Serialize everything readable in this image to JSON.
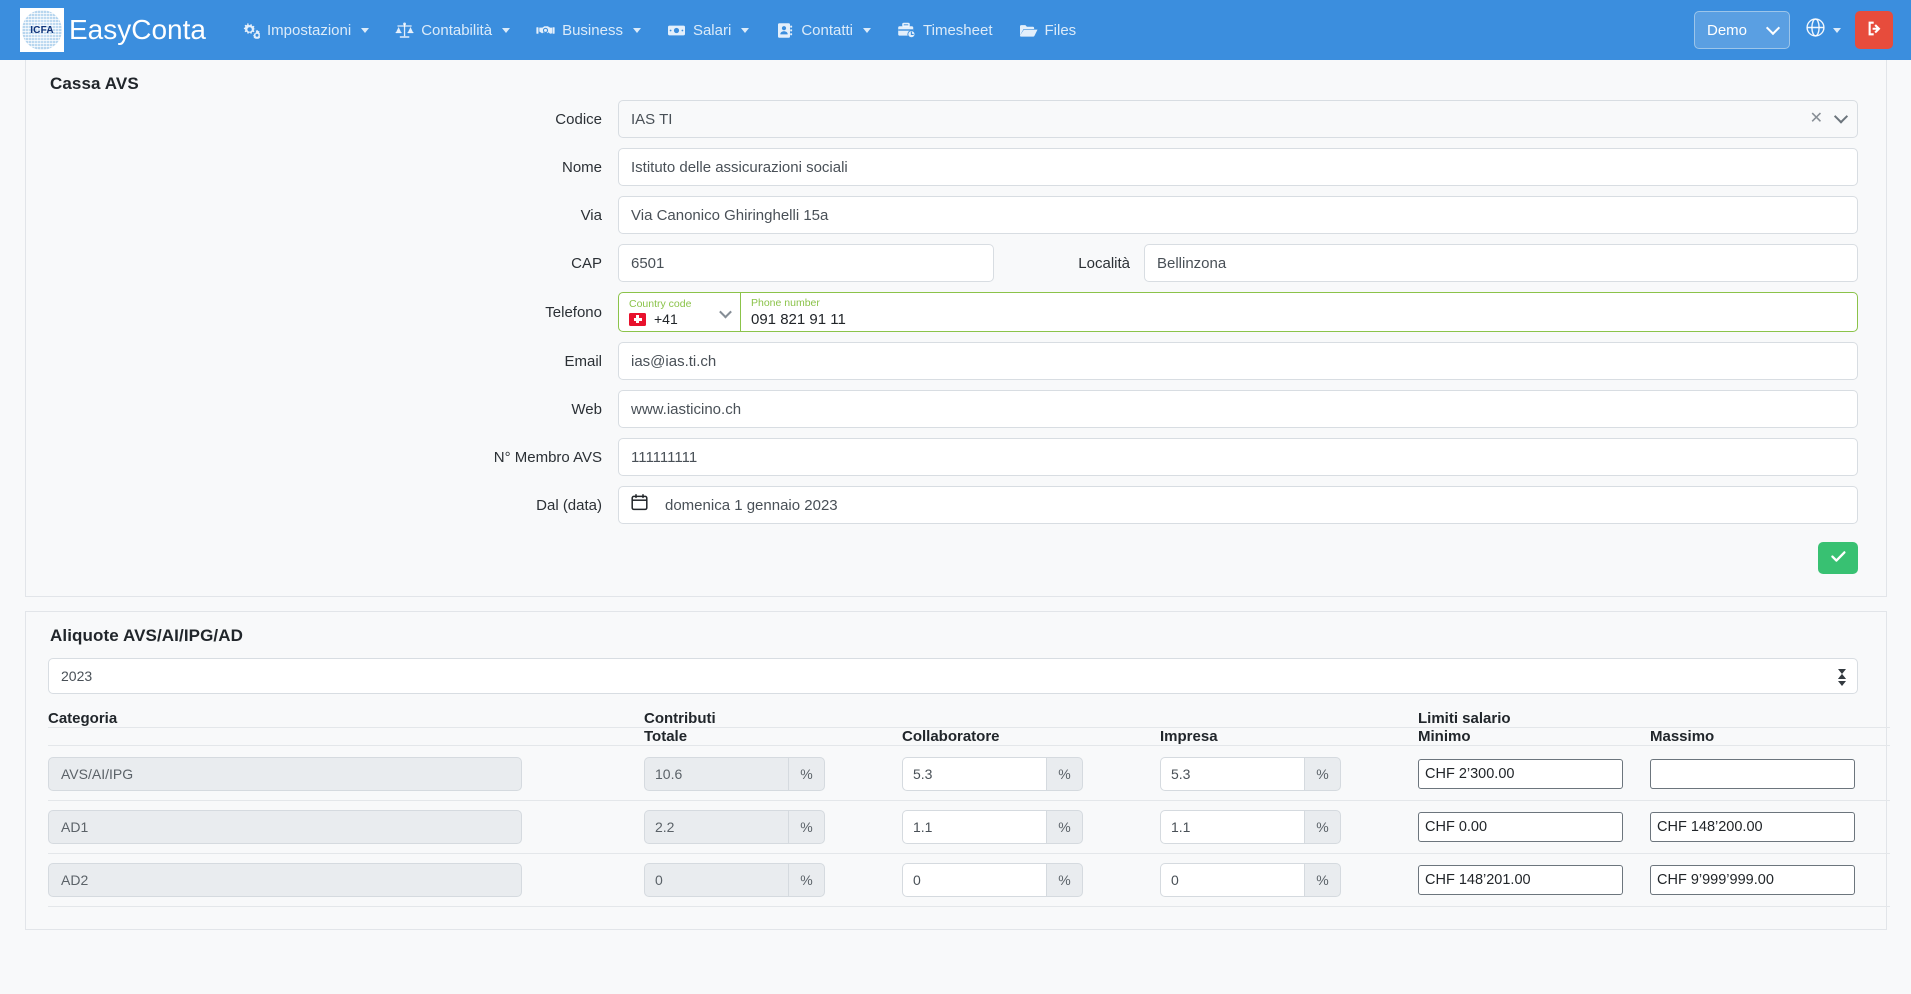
{
  "navbar": {
    "logo_text": "ICFA",
    "brand": "EasyConta",
    "items": [
      {
        "label": "Impostazioni",
        "icon": "gears-icon",
        "caret": true
      },
      {
        "label": "Contabilità",
        "icon": "balance-scale-icon",
        "caret": true
      },
      {
        "label": "Business",
        "icon": "handshake-icon",
        "caret": true
      },
      {
        "label": "Salari",
        "icon": "money-bill-icon",
        "caret": true
      },
      {
        "label": "Contatti",
        "icon": "address-book-icon",
        "caret": true
      },
      {
        "label": "Timesheet",
        "icon": "briefcase-clock-icon",
        "caret": false
      },
      {
        "label": "Files",
        "icon": "folder-open-icon",
        "caret": false
      }
    ],
    "company_select": "Demo",
    "language_icon": "globe-icon",
    "logout_icon": "logout-icon",
    "colors": {
      "navbar_bg": "#3b8ede",
      "logout_bg": "#e74c3c"
    }
  },
  "cassa_avs": {
    "title": "Cassa AVS",
    "codice": {
      "label": "Codice",
      "value": "IAS TI"
    },
    "nome": {
      "label": "Nome",
      "value": "Istituto delle assicurazioni sociali"
    },
    "via": {
      "label": "Via",
      "value": "Via Canonico Ghiringhelli 15a"
    },
    "cap": {
      "label": "CAP",
      "value": "6501"
    },
    "localita": {
      "label": "Località",
      "value": "Bellinzona"
    },
    "telefono": {
      "label": "Telefono",
      "country_code_label": "Country code",
      "country_code_value": "+41",
      "country_flag": "swiss-flag-icon",
      "phone_label": "Phone number",
      "phone_value": "091 821 91 11"
    },
    "email": {
      "label": "Email",
      "value": "ias@ias.ti.ch"
    },
    "web": {
      "label": "Web",
      "value": "www.iasticino.ch"
    },
    "membro_avs": {
      "label": "N° Membro AVS",
      "value": "111111111"
    },
    "dal_data": {
      "label": "Dal (data)",
      "value": "domenica 1 gennaio 2023",
      "icon": "calendar-icon"
    },
    "save_icon": "check-icon",
    "save_color": "#38c172"
  },
  "aliquote": {
    "title": "Aliquote AVS/AI/IPG/AD",
    "year": "2023",
    "headers": {
      "categoria": "Categoria",
      "contributi": "Contributi",
      "limiti_salario": "Limiti salario",
      "totale": "Totale",
      "collaboratore": "Collaboratore",
      "impresa": "Impresa",
      "minimo": "Minimo",
      "massimo": "Massimo"
    },
    "percent_suffix": "%",
    "rows": [
      {
        "categoria": "AVS/AI/IPG",
        "totale": "10.6",
        "collaboratore": "5.3",
        "impresa": "5.3",
        "minimo": "CHF 2’300.00",
        "massimo": ""
      },
      {
        "categoria": "AD1",
        "totale": "2.2",
        "collaboratore": "1.1",
        "impresa": "1.1",
        "minimo": "CHF 0.00",
        "massimo": "CHF 148’200.00"
      },
      {
        "categoria": "AD2",
        "totale": "0",
        "collaboratore": "0",
        "impresa": "0",
        "minimo": "CHF 148’201.00",
        "massimo": "CHF 9’999’999.00"
      }
    ]
  }
}
